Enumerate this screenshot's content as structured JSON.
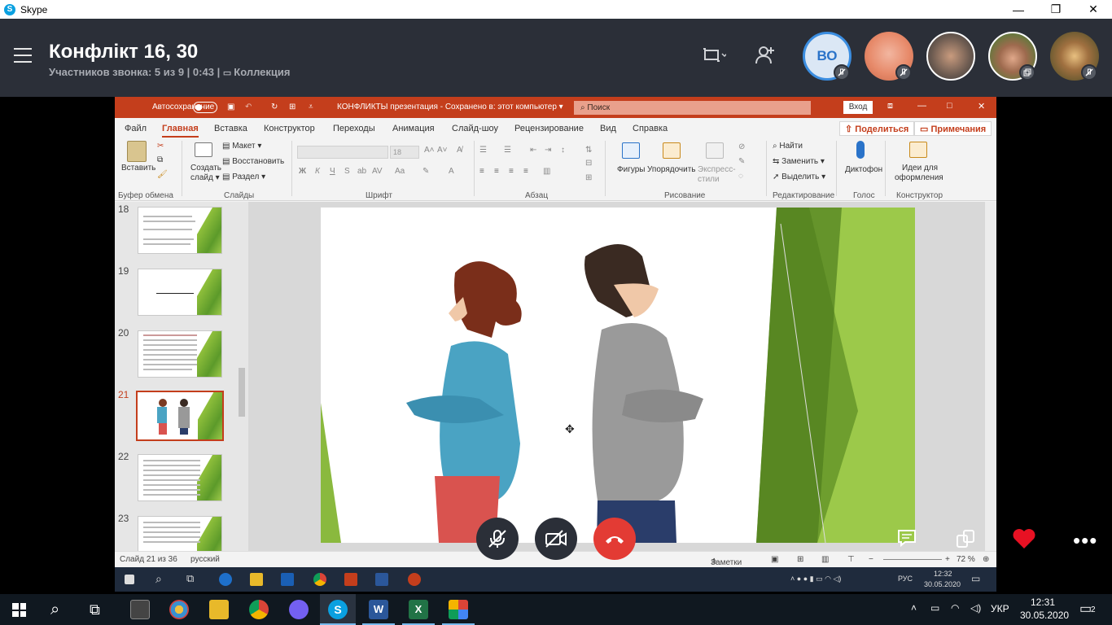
{
  "skype": {
    "title": "Skype",
    "window_buttons": [
      "—",
      "❐",
      "✕"
    ]
  },
  "call": {
    "title": "Конфлікт 16, 30",
    "subtitle": "Участников звонка: 5 из 9 | 0:43 | ",
    "collection": "Коллекция",
    "participants": [
      {
        "initials": "ВО",
        "muted": true
      },
      {
        "initials": "",
        "muted": true
      },
      {
        "initials": "",
        "muted": false
      },
      {
        "initials": "",
        "muted": false
      },
      {
        "initials": "",
        "muted": true
      }
    ]
  },
  "ppt": {
    "autosave": "Автосохранение",
    "doc_title": "КОНФЛИКТЫ презентация - Сохранено в: этот компьютер ▾",
    "search_placeholder": "Поиск",
    "login": "Вход",
    "menu": [
      "Файл",
      "Главная",
      "Вставка",
      "Конструктор",
      "Переходы",
      "Анимация",
      "Слайд-шоу",
      "Рецензирование",
      "Вид",
      "Справка"
    ],
    "active_menu": "Главная",
    "share": "Поделиться",
    "comments": "Примечания",
    "ribbon": {
      "paste": "Вставить",
      "create_slide": "Создать слайд ▾",
      "layout": "Макет ▾",
      "restore": "Восстановить",
      "section": "Раздел ▾",
      "font_size": "18",
      "shapes": "Фигуры",
      "arrange": "Упорядочить",
      "express_styles": "Экспресс-стили",
      "find": "Найти",
      "replace": "Заменить ▾",
      "select": "Выделить ▾",
      "dictate": "Диктофон",
      "design_ideas_1": "Идеи для",
      "design_ideas_2": "оформления",
      "groups": [
        "Буфер обмена",
        "Слайды",
        "Шрифт",
        "Абзац",
        "Рисование",
        "Редактирование",
        "Голос",
        "Конструктор"
      ]
    },
    "thumbnails": [
      {
        "num": "18",
        "active": false
      },
      {
        "num": "19",
        "active": false
      },
      {
        "num": "20",
        "active": false
      },
      {
        "num": "21",
        "active": true
      },
      {
        "num": "22",
        "active": false
      },
      {
        "num": "23",
        "active": false
      }
    ],
    "status": {
      "slide": "Слайд 21 из 36",
      "lang": "русский",
      "notes": "Заметки",
      "zoom": "72 %"
    }
  },
  "remote_taskbar": {
    "lang": "РУС",
    "time": "12:32",
    "date": "30.05.2020"
  },
  "taskbar": {
    "lang": "УКР",
    "time": "12:31",
    "date": "30.05.2020",
    "notifications": "2"
  },
  "colors": {
    "skype_header": "#2b2f38",
    "ppt_accent": "#c43e1c",
    "hangup": "#e33b34",
    "heart": "#e81123"
  }
}
